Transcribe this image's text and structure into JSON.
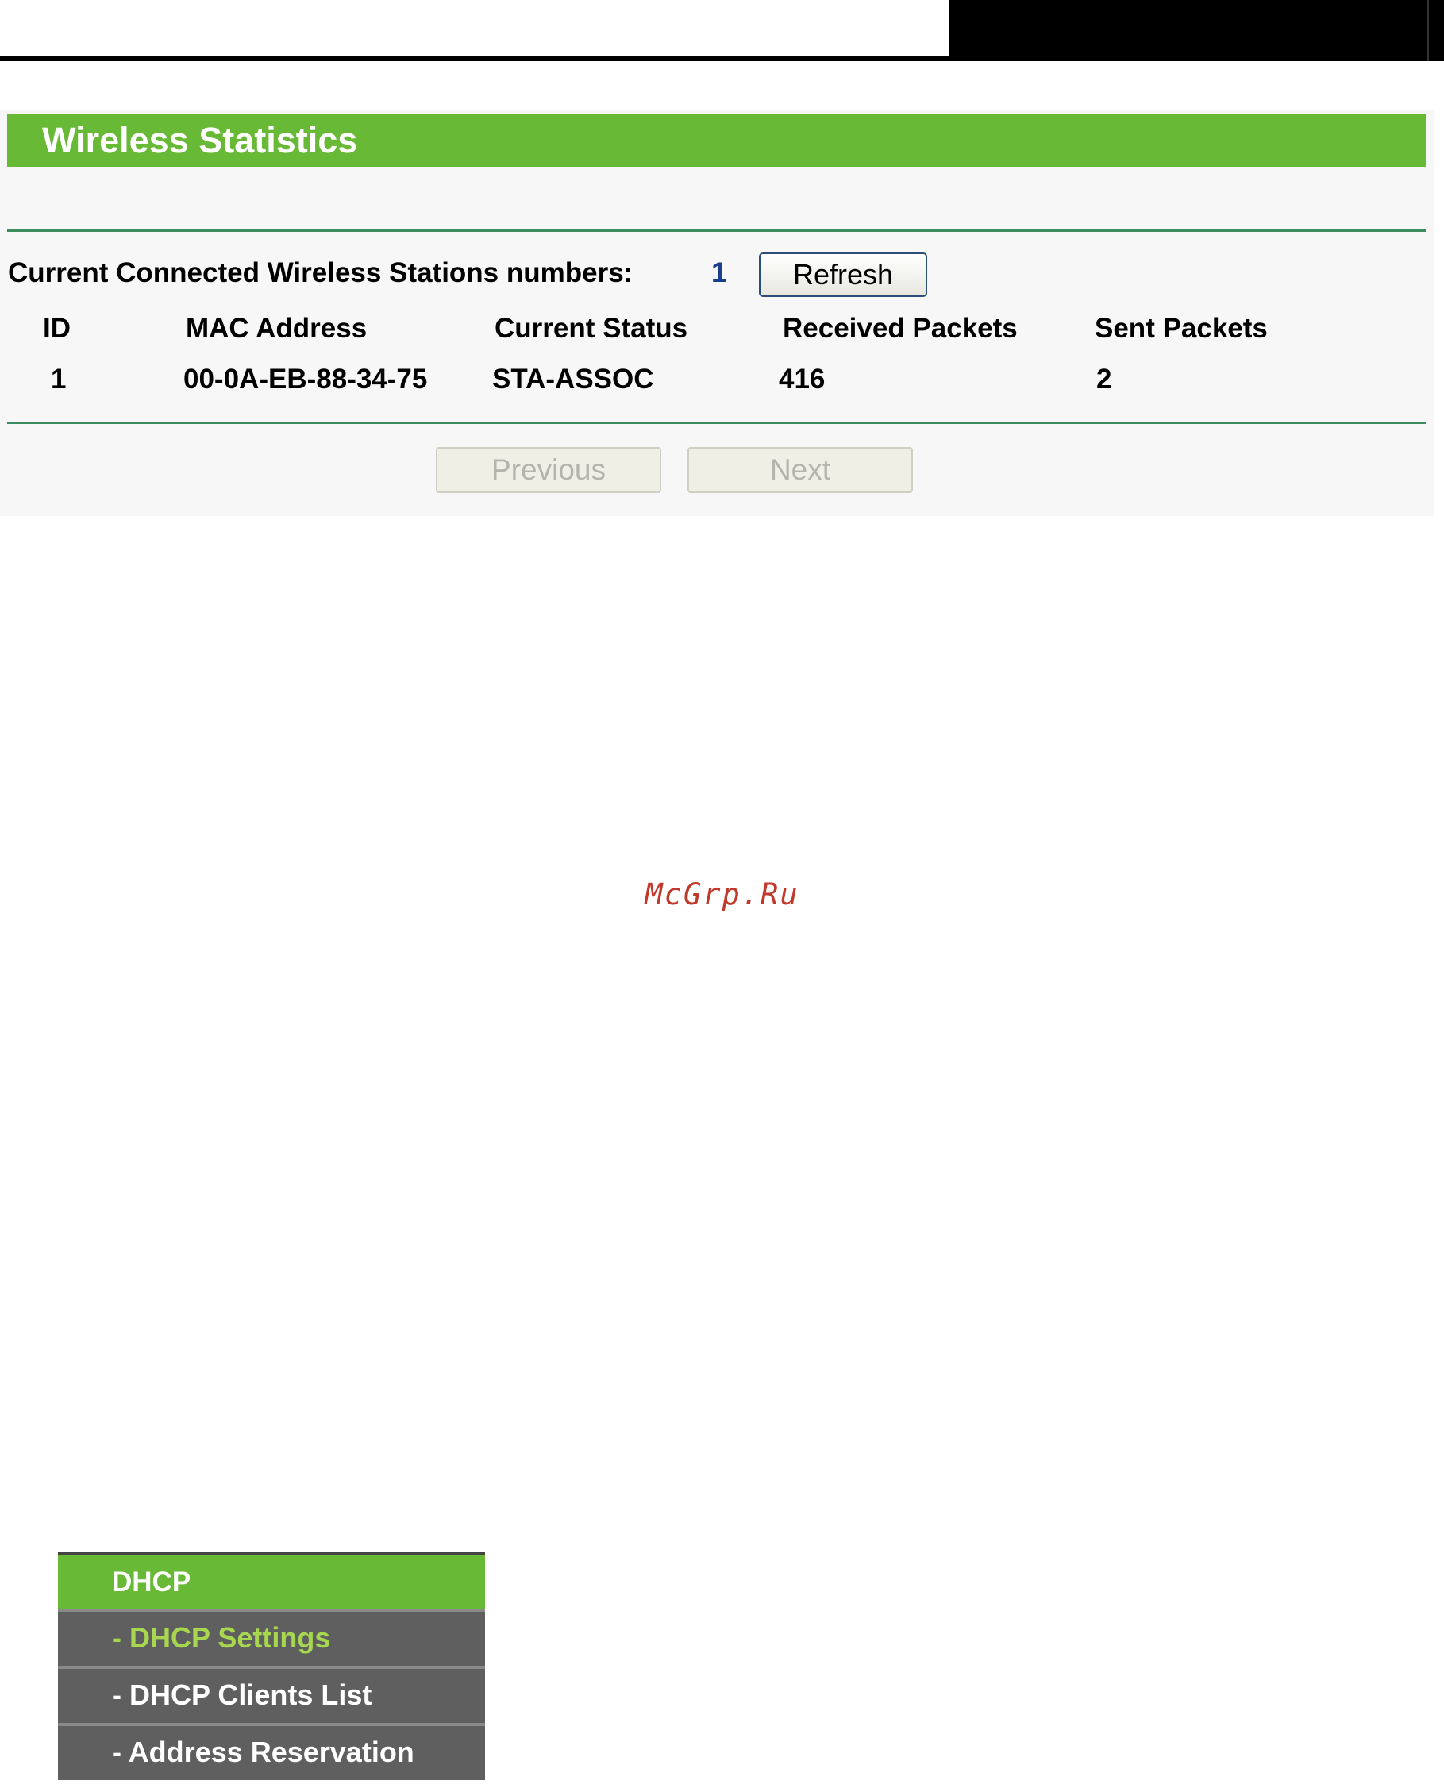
{
  "panel": {
    "title": "Wireless Statistics",
    "connected_label": "Current Connected Wireless Stations numbers:",
    "connected_count": "1",
    "refresh_label": "Refresh",
    "columns": [
      "ID",
      "MAC Address",
      "Current Status",
      "Received Packets",
      "Sent Packets"
    ],
    "rows": [
      [
        "1",
        "00-0A-EB-88-34-75",
        "STA-ASSOC",
        "416",
        "2"
      ]
    ],
    "previous_label": "Previous",
    "next_label": "Next"
  },
  "watermark": "McGrp.Ru",
  "menu": {
    "title": "DHCP",
    "items": [
      {
        "label": "- DHCP Settings",
        "active": true
      },
      {
        "label": "- DHCP Clients List",
        "active": false
      },
      {
        "label": "- Address Reservation",
        "active": false
      }
    ]
  },
  "colors": {
    "header_green": "#67b936",
    "rule_green": "#3d8c5f",
    "menu_gray": "#5f5f5f",
    "active_item": "#a7d64f",
    "count_blue": "#1a3d8c"
  }
}
